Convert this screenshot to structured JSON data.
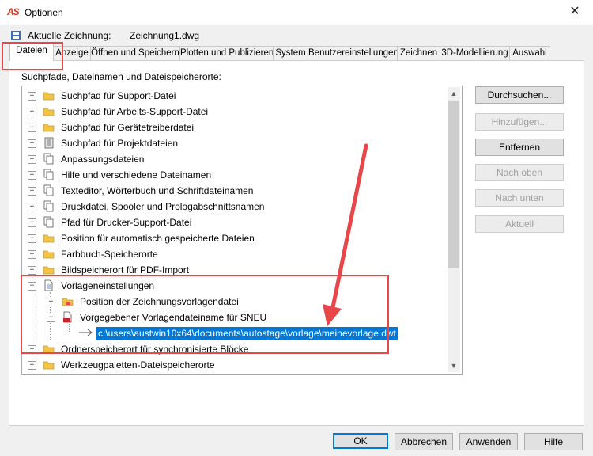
{
  "window": {
    "title": "Optionen",
    "close_glyph": "✕"
  },
  "current_drawing": {
    "label": "Aktuelle Zeichnung:",
    "value": "Zeichnung1.dwg"
  },
  "tabs": [
    "Dateien",
    "Anzeige",
    "Öffnen und Speichern",
    "Plotten und Publizieren",
    "System",
    "Benutzereinstellungen",
    "Zeichnen",
    "3D-Modellierung",
    "Auswahl"
  ],
  "active_tab": "Dateien",
  "section_label": "Suchpfade, Dateinamen und Dateispeicherorte:",
  "tree": [
    {
      "label": "Suchpfad für Support-Datei",
      "icon": "folder-icon"
    },
    {
      "label": "Suchpfad für Arbeits-Support-Datei",
      "icon": "folder-icon"
    },
    {
      "label": "Suchpfad für Gerätetreiberdatei",
      "icon": "folder-icon"
    },
    {
      "label": "Suchpfad für Projektdateien",
      "icon": "project-icon"
    },
    {
      "label": "Anpassungsdateien",
      "icon": "files-icon"
    },
    {
      "label": "Hilfe und verschiedene Dateinamen",
      "icon": "files-icon"
    },
    {
      "label": "Texteditor, Wörterbuch und Schriftdateinamen",
      "icon": "files-icon"
    },
    {
      "label": "Druckdatei, Spooler und Prologabschnittsnamen",
      "icon": "files-icon"
    },
    {
      "label": "Pfad für Drucker-Support-Datei",
      "icon": "files-icon"
    },
    {
      "label": "Position für automatisch gespeicherte Dateien",
      "icon": "folder-icon"
    },
    {
      "label": "Farbbuch-Speicherorte",
      "icon": "folder-icon"
    },
    {
      "label": "Bildspeicherort für PDF-Import",
      "icon": "folder-icon"
    },
    {
      "label": "Vorlageneinstellungen",
      "icon": "template-icon"
    },
    {
      "label": "Position der Zeichnungsvorlagendatei",
      "icon": "folder-icon"
    },
    {
      "label": "Vorgegebener Vorlagendateiname für SNEU",
      "icon": "dwt-icon"
    },
    {
      "label": "c:\\users\\austwin10x64\\documents\\autostage\\vorlage\\meinevorlage.dwt",
      "icon": "arrow-icon"
    },
    {
      "label": "Ordnerspeicherort für synchronisierte Blöcke",
      "icon": "folder-icon"
    },
    {
      "label": "Werkzeugpaletten-Dateispeicherorte",
      "icon": "folder-icon"
    }
  ],
  "side_buttons": [
    "Durchsuchen...",
    "Hinzufügen...",
    "Entfernen",
    "Nach oben",
    "Nach unten",
    "Aktuell"
  ],
  "bottom_buttons": [
    "OK",
    "Abbrechen",
    "Anwenden",
    "Hilfe"
  ],
  "colors": {
    "selection": "#0078d7",
    "annotation": "#e8474a",
    "folder": "#f5c342"
  }
}
